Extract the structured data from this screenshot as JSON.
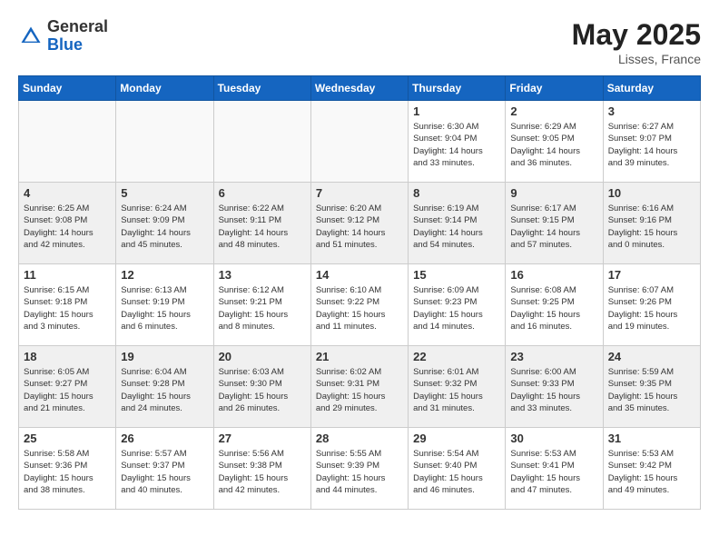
{
  "header": {
    "logo_general": "General",
    "logo_blue": "Blue",
    "month": "May 2025",
    "location": "Lisses, France"
  },
  "weekdays": [
    "Sunday",
    "Monday",
    "Tuesday",
    "Wednesday",
    "Thursday",
    "Friday",
    "Saturday"
  ],
  "weeks": [
    [
      {
        "day": "",
        "info": ""
      },
      {
        "day": "",
        "info": ""
      },
      {
        "day": "",
        "info": ""
      },
      {
        "day": "",
        "info": ""
      },
      {
        "day": "1",
        "info": "Sunrise: 6:30 AM\nSunset: 9:04 PM\nDaylight: 14 hours\nand 33 minutes."
      },
      {
        "day": "2",
        "info": "Sunrise: 6:29 AM\nSunset: 9:05 PM\nDaylight: 14 hours\nand 36 minutes."
      },
      {
        "day": "3",
        "info": "Sunrise: 6:27 AM\nSunset: 9:07 PM\nDaylight: 14 hours\nand 39 minutes."
      }
    ],
    [
      {
        "day": "4",
        "info": "Sunrise: 6:25 AM\nSunset: 9:08 PM\nDaylight: 14 hours\nand 42 minutes."
      },
      {
        "day": "5",
        "info": "Sunrise: 6:24 AM\nSunset: 9:09 PM\nDaylight: 14 hours\nand 45 minutes."
      },
      {
        "day": "6",
        "info": "Sunrise: 6:22 AM\nSunset: 9:11 PM\nDaylight: 14 hours\nand 48 minutes."
      },
      {
        "day": "7",
        "info": "Sunrise: 6:20 AM\nSunset: 9:12 PM\nDaylight: 14 hours\nand 51 minutes."
      },
      {
        "day": "8",
        "info": "Sunrise: 6:19 AM\nSunset: 9:14 PM\nDaylight: 14 hours\nand 54 minutes."
      },
      {
        "day": "9",
        "info": "Sunrise: 6:17 AM\nSunset: 9:15 PM\nDaylight: 14 hours\nand 57 minutes."
      },
      {
        "day": "10",
        "info": "Sunrise: 6:16 AM\nSunset: 9:16 PM\nDaylight: 15 hours\nand 0 minutes."
      }
    ],
    [
      {
        "day": "11",
        "info": "Sunrise: 6:15 AM\nSunset: 9:18 PM\nDaylight: 15 hours\nand 3 minutes."
      },
      {
        "day": "12",
        "info": "Sunrise: 6:13 AM\nSunset: 9:19 PM\nDaylight: 15 hours\nand 6 minutes."
      },
      {
        "day": "13",
        "info": "Sunrise: 6:12 AM\nSunset: 9:21 PM\nDaylight: 15 hours\nand 8 minutes."
      },
      {
        "day": "14",
        "info": "Sunrise: 6:10 AM\nSunset: 9:22 PM\nDaylight: 15 hours\nand 11 minutes."
      },
      {
        "day": "15",
        "info": "Sunrise: 6:09 AM\nSunset: 9:23 PM\nDaylight: 15 hours\nand 14 minutes."
      },
      {
        "day": "16",
        "info": "Sunrise: 6:08 AM\nSunset: 9:25 PM\nDaylight: 15 hours\nand 16 minutes."
      },
      {
        "day": "17",
        "info": "Sunrise: 6:07 AM\nSunset: 9:26 PM\nDaylight: 15 hours\nand 19 minutes."
      }
    ],
    [
      {
        "day": "18",
        "info": "Sunrise: 6:05 AM\nSunset: 9:27 PM\nDaylight: 15 hours\nand 21 minutes."
      },
      {
        "day": "19",
        "info": "Sunrise: 6:04 AM\nSunset: 9:28 PM\nDaylight: 15 hours\nand 24 minutes."
      },
      {
        "day": "20",
        "info": "Sunrise: 6:03 AM\nSunset: 9:30 PM\nDaylight: 15 hours\nand 26 minutes."
      },
      {
        "day": "21",
        "info": "Sunrise: 6:02 AM\nSunset: 9:31 PM\nDaylight: 15 hours\nand 29 minutes."
      },
      {
        "day": "22",
        "info": "Sunrise: 6:01 AM\nSunset: 9:32 PM\nDaylight: 15 hours\nand 31 minutes."
      },
      {
        "day": "23",
        "info": "Sunrise: 6:00 AM\nSunset: 9:33 PM\nDaylight: 15 hours\nand 33 minutes."
      },
      {
        "day": "24",
        "info": "Sunrise: 5:59 AM\nSunset: 9:35 PM\nDaylight: 15 hours\nand 35 minutes."
      }
    ],
    [
      {
        "day": "25",
        "info": "Sunrise: 5:58 AM\nSunset: 9:36 PM\nDaylight: 15 hours\nand 38 minutes."
      },
      {
        "day": "26",
        "info": "Sunrise: 5:57 AM\nSunset: 9:37 PM\nDaylight: 15 hours\nand 40 minutes."
      },
      {
        "day": "27",
        "info": "Sunrise: 5:56 AM\nSunset: 9:38 PM\nDaylight: 15 hours\nand 42 minutes."
      },
      {
        "day": "28",
        "info": "Sunrise: 5:55 AM\nSunset: 9:39 PM\nDaylight: 15 hours\nand 44 minutes."
      },
      {
        "day": "29",
        "info": "Sunrise: 5:54 AM\nSunset: 9:40 PM\nDaylight: 15 hours\nand 46 minutes."
      },
      {
        "day": "30",
        "info": "Sunrise: 5:53 AM\nSunset: 9:41 PM\nDaylight: 15 hours\nand 47 minutes."
      },
      {
        "day": "31",
        "info": "Sunrise: 5:53 AM\nSunset: 9:42 PM\nDaylight: 15 hours\nand 49 minutes."
      }
    ]
  ]
}
